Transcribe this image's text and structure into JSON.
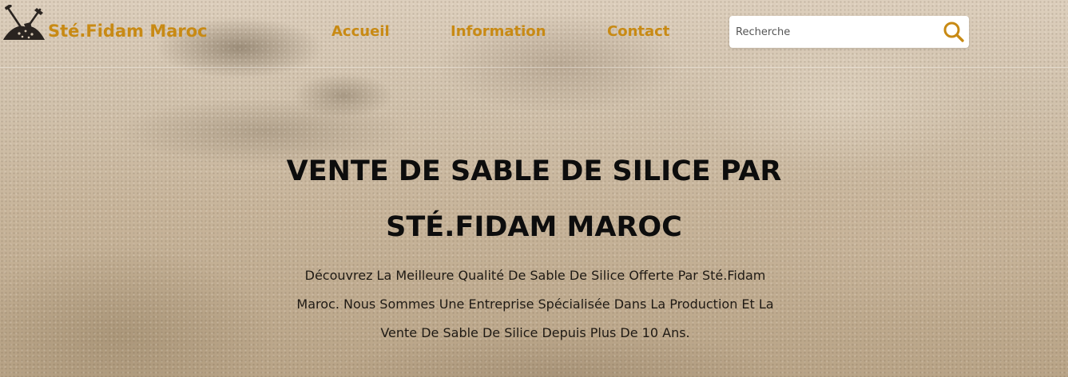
{
  "brand": {
    "name": "Sté.Fidam Maroc",
    "logo_icon": "sand-shovel-icon",
    "color": "#c88a14"
  },
  "nav": {
    "items": [
      {
        "label": "Accueil"
      },
      {
        "label": "Information"
      },
      {
        "label": "Contact"
      }
    ]
  },
  "search": {
    "placeholder": "Recherche",
    "value": "",
    "icon": "search-icon"
  },
  "hero": {
    "title_lines": [
      "VENTE DE SABLE DE SILICE PAR",
      "STÉ.FIDAM MAROC"
    ],
    "description_lines": [
      "Découvrez La Meilleure Qualité De Sable De Silice Offerte Par Sté.Fidam",
      "Maroc. Nous Sommes Une Entreprise Spécialisée Dans La Production Et La",
      "Vente De Sable De Silice Depuis Plus De 10 Ans."
    ]
  }
}
